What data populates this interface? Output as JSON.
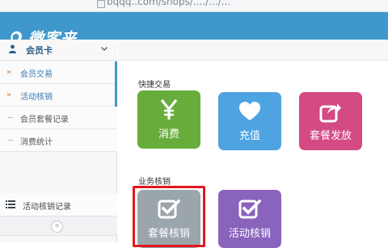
{
  "browser": {
    "url": "bqqq..com/shops/..../.../..."
  },
  "app": {
    "logo_text": "微客来"
  },
  "sidebar": {
    "header": {
      "label": "会员卡",
      "icon": "user-icon",
      "chevron": "chevron-down-icon"
    },
    "items": [
      {
        "label": "会员交易",
        "kind": "bullet"
      },
      {
        "label": "活动核销",
        "kind": "bullet"
      },
      {
        "label": "会员套餐记录",
        "kind": "dash"
      },
      {
        "label": "消费统计",
        "kind": "dash"
      }
    ],
    "record_item": {
      "label": "活动核销记录",
      "icon": "list-icon"
    },
    "collapse": {
      "label": "«",
      "icon": "double-left-icon"
    }
  },
  "main": {
    "quick_trade": {
      "title": "快捷交易",
      "tiles": [
        {
          "label": "消费",
          "icon": "yen-icon",
          "color": "#68ad3b"
        },
        {
          "label": "充值",
          "icon": "heart-icon",
          "color": "#4ea4e0"
        },
        {
          "label": "套餐发放",
          "icon": "share-icon",
          "color": "#d44a83"
        }
      ]
    },
    "verification": {
      "title": "业务核销",
      "tiles": [
        {
          "label": "套餐核销",
          "icon": "checkmark-icon",
          "color": "#9ba5ac"
        },
        {
          "label": "活动核销",
          "icon": "checkmark-icon",
          "color": "#8a63bd"
        }
      ]
    }
  },
  "colors": {
    "header": "#3f98cc",
    "sidebar_bg": "#f7f7f7",
    "highlight": "#e4171d"
  }
}
